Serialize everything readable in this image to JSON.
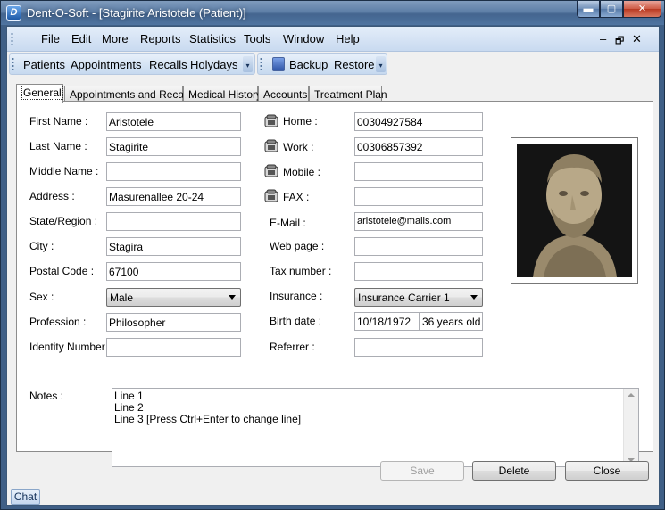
{
  "window": {
    "title": "Dent-O-Soft - [Stagirite Aristotele (Patient)]",
    "app_icon_glyph": "D",
    "min_glyph": "▬",
    "max_glyph": "▢",
    "close_glyph": "✕"
  },
  "menu": {
    "items": [
      "File",
      "Edit",
      "More",
      "Reports",
      "Statistics",
      "Tools",
      "Window",
      "Help"
    ],
    "mdi_min": "–",
    "mdi_restore": "🗗",
    "mdi_close": "✕"
  },
  "toolbar": {
    "group1": [
      "Patients",
      "Appointments",
      "Recalls",
      "Holydays"
    ],
    "group2": [
      "Backup",
      "Restore"
    ],
    "overflow_glyph": "▾"
  },
  "tabs": [
    "General",
    "Appointments and Recalls",
    "Medical History",
    "Accounts",
    "Treatment Plan"
  ],
  "left_fields": [
    {
      "label": "First Name :",
      "value": "Aristotele"
    },
    {
      "label": "Last Name :",
      "value": "Stagirite"
    },
    {
      "label": "Middle Name :",
      "value": ""
    },
    {
      "label": "Address :",
      "value": "Masurenallee 20-24"
    },
    {
      "label": "State/Region :",
      "value": ""
    },
    {
      "label": "City :",
      "value": "Stagira"
    },
    {
      "label": "Postal Code :",
      "value": "67100"
    },
    {
      "label": "Sex :",
      "value": "Male"
    },
    {
      "label": "Profession :",
      "value": "Philosopher"
    },
    {
      "label": "Identity Number :",
      "value": ""
    }
  ],
  "right_fields": [
    {
      "label": "Home :",
      "value": "00304927584",
      "icon": "phone-icon"
    },
    {
      "label": "Work :",
      "value": "00306857392",
      "icon": "phone-icon"
    },
    {
      "label": "Mobile :",
      "value": "",
      "icon": "phone-icon"
    },
    {
      "label": "FAX :",
      "value": "",
      "icon": "fax-icon"
    },
    {
      "label": "E-Mail :",
      "value": "aristotele@mails.com"
    },
    {
      "label": "Web page :",
      "value": ""
    },
    {
      "label": "Tax number :",
      "value": ""
    },
    {
      "label": "Insurance :",
      "value": "Insurance Carrier 1"
    },
    {
      "label": "Birth date :",
      "value": "10/18/1972",
      "extra": "36 years old"
    },
    {
      "label": "Referrer :",
      "value": ""
    }
  ],
  "notes": {
    "label": "Notes :",
    "lines": [
      "Line 1",
      "Line 2",
      "Line 3 [Press Ctrl+Enter to change line]"
    ]
  },
  "buttons": {
    "save": "Save",
    "delete": "Delete",
    "close": "Close"
  },
  "status": {
    "chat": "Chat"
  },
  "colors": {
    "titlebar": "#44658f",
    "menubar": "#d6e4f5",
    "panel": "#ffffff"
  }
}
